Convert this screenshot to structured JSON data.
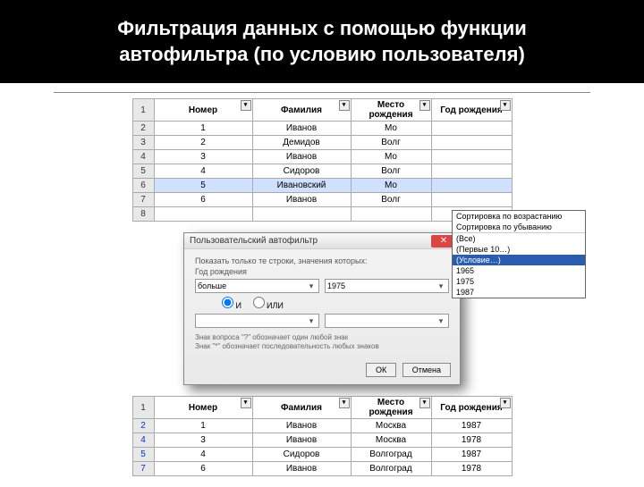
{
  "title": {
    "line1": "Фильтрация данных с помощью функции",
    "line2": "автофильтра (по условию пользователя)"
  },
  "headers": {
    "num": "Номер",
    "surname": "Фамилия",
    "birthplace": "Место рождения",
    "birthyear": "Год рождения"
  },
  "table1": {
    "rows": [
      {
        "r": "2",
        "n": "1",
        "s": "Иванов",
        "p": "Мо",
        "y": ""
      },
      {
        "r": "3",
        "n": "2",
        "s": "Демидов",
        "p": "Волг",
        "y": ""
      },
      {
        "r": "4",
        "n": "3",
        "s": "Иванов",
        "p": "Мо",
        "y": ""
      },
      {
        "r": "5",
        "n": "4",
        "s": "Сидоров",
        "p": "Волг",
        "y": ""
      },
      {
        "r": "6",
        "n": "5",
        "s": "Ивановский",
        "p": "Мо",
        "y": ""
      },
      {
        "r": "7",
        "n": "6",
        "s": "Иванов",
        "p": "Волг",
        "y": ""
      },
      {
        "r": "8",
        "n": "",
        "s": "",
        "p": "",
        "y": ""
      }
    ]
  },
  "filterMenu": {
    "sortAsc": "Сортировка по возрастанию",
    "sortDesc": "Сортировка по убыванию",
    "all": "(Все)",
    "top10": "(Первые 10…)",
    "condition": "(Условие…)",
    "v1": "1965",
    "v2": "1975",
    "v3": "1987"
  },
  "dialog": {
    "title": "Пользовательский автофильтр",
    "instr": "Показать только те строки, значения которых:",
    "field": "Год рождения",
    "op1": "больше",
    "val1": "1975",
    "and": "И",
    "or": "ИЛИ",
    "hint1": "Знак вопроса \"?\" обозначает один любой знак",
    "hint2": "Знак \"*\" обозначает последовательность любых знаков",
    "ok": "ОК",
    "cancel": "Отмена"
  },
  "table2": {
    "rows": [
      {
        "r": "2",
        "n": "1",
        "s": "Иванов",
        "p": "Москва",
        "y": "1987"
      },
      {
        "r": "4",
        "n": "3",
        "s": "Иванов",
        "p": "Москва",
        "y": "1978"
      },
      {
        "r": "5",
        "n": "4",
        "s": "Сидоров",
        "p": "Волгоград",
        "y": "1987"
      },
      {
        "r": "7",
        "n": "6",
        "s": "Иванов",
        "p": "Волгоград",
        "y": "1978"
      }
    ]
  }
}
